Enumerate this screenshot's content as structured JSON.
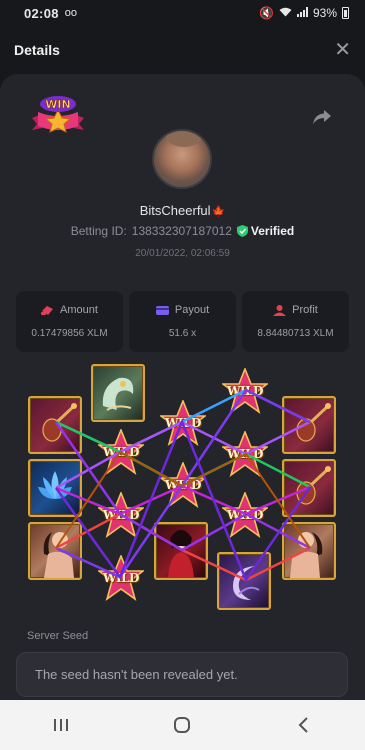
{
  "status_bar": {
    "time": "02:08",
    "voicemail": "oo",
    "battery": "93%"
  },
  "header": {
    "title": "Details"
  },
  "player": {
    "username": "BitsCheerful",
    "flag": "🍁",
    "betting_id_label": "Betting ID:",
    "betting_id": "138332307187012",
    "verified_label": "Verified",
    "timestamp": "20/01/2022, 02:06:59"
  },
  "stats": [
    {
      "label": "Amount",
      "value": "0.17479856 XLM",
      "color": "#e2405a"
    },
    {
      "label": "Payout",
      "value": "51.6 x",
      "color": "#7b5cf0"
    },
    {
      "label": "Profit",
      "value": "8.84480713 XLM",
      "color": "#e0454e"
    }
  ],
  "reels": {
    "wild_label": "WILD",
    "symbols": [
      [
        "guitar",
        "lotus",
        "lady"
      ],
      [
        "jade-dragon",
        "wild",
        "wild",
        "wild"
      ],
      [
        "wild",
        "wild",
        "geisha"
      ],
      [
        "wild",
        "wild",
        "wild",
        "moon-dragon"
      ],
      [
        "guitar",
        "guitar",
        "lady"
      ]
    ]
  },
  "logo_text": "WIN",
  "server_seed": {
    "label": "Server Seed",
    "value": "The seed hasn't been revealed yet."
  },
  "colors": {
    "accent_gold": "#d6a63c",
    "verified_green": "#2ecc71",
    "wild_pink": "#e0336f"
  }
}
